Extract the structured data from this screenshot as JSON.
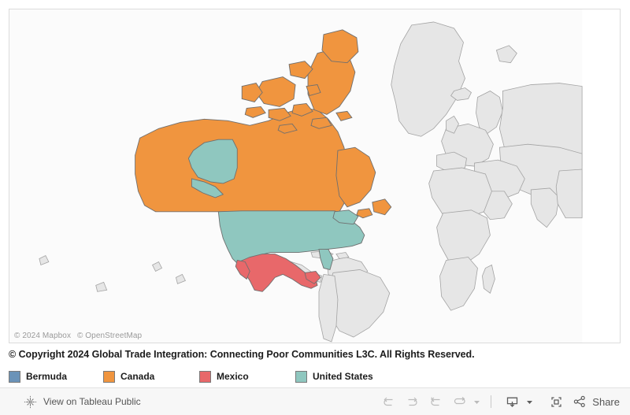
{
  "map": {
    "attribution": [
      "© 2024 Mapbox",
      "© OpenStreetMap"
    ],
    "background_color": "#fbfbfb",
    "unhighlighted_country_fill": "#e6e6e6",
    "country_border_color": "#9a9a9a",
    "frame_border_color": "#dcdcdc"
  },
  "caption": {
    "copyright_text": "© Copyright 2024 Global Trade Integration: Connecting Poor Communities L3C. All Rights Reserved."
  },
  "legend": {
    "items": [
      {
        "label": "Bermuda",
        "color": "#6b93b8"
      },
      {
        "label": "Canada",
        "color": "#f0953f"
      },
      {
        "label": "Mexico",
        "color": "#e8686a"
      },
      {
        "label": "United States",
        "color": "#8fc7bf"
      }
    ]
  },
  "toolbar": {
    "tableau_public_label": "View on Tableau Public",
    "tableau_icon": "tableau-logo-icon",
    "buttons": [
      {
        "name": "undo-button",
        "icon": "undo-icon",
        "label": "Undo",
        "enabled": false
      },
      {
        "name": "redo-button",
        "icon": "redo-icon",
        "label": "Redo",
        "enabled": false
      },
      {
        "name": "revert-button",
        "icon": "revert-icon",
        "label": "Revert",
        "enabled": false
      },
      {
        "name": "refresh-button",
        "icon": "refresh-icon",
        "label": "Refresh",
        "enabled": false
      },
      {
        "name": "pause-caret",
        "icon": "chevron-down-icon",
        "label": "",
        "enabled": false
      },
      {
        "name": "download-button",
        "icon": "download-icon",
        "label": "Download",
        "enabled": true
      },
      {
        "name": "download-caret",
        "icon": "chevron-down-icon",
        "label": "",
        "enabled": true
      },
      {
        "name": "fullscreen-button",
        "icon": "fullscreen-icon",
        "label": "Full Screen",
        "enabled": true
      }
    ],
    "share_label": "Share",
    "share_icon": "share-icon",
    "background_color": "#f7f7f7"
  }
}
